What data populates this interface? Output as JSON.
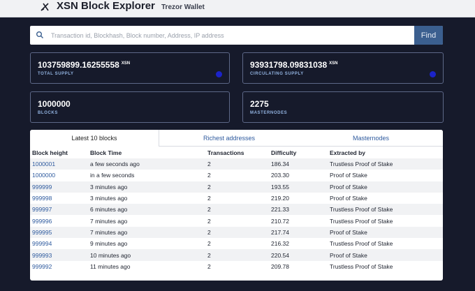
{
  "header": {
    "brand": "XSN Block Explorer",
    "wallet_link": "Trezor Wallet",
    "logo_icon": "xsn-logo-icon"
  },
  "search": {
    "placeholder": "Transaction id, Blockhash, Block number, Address, IP address",
    "button_label": "Find",
    "icon": "search-icon"
  },
  "stats": {
    "total_supply": {
      "value": "103759899.16255558",
      "unit": "XSN",
      "label": "TOTAL SUPPLY"
    },
    "circulating_supply": {
      "value": "93931798.09831038",
      "unit": "XSN",
      "label": "CIRCULATING SUPPLY"
    },
    "blocks": {
      "value": "1000000",
      "label": "BLOCKS"
    },
    "masternodes": {
      "value": "2275",
      "label": "MASTERNODES"
    }
  },
  "tabs": [
    {
      "label": "Latest 10 blocks"
    },
    {
      "label": "Richest addresses"
    },
    {
      "label": "Masternodes"
    }
  ],
  "table": {
    "headers": [
      "Block height",
      "Block Time",
      "Transactions",
      "Difficulty",
      "Extracted by"
    ],
    "rows": [
      [
        "1000001",
        "a few seconds ago",
        "2",
        "186.34",
        "Trustless Proof of Stake"
      ],
      [
        "1000000",
        "in a few seconds",
        "2",
        "203.30",
        "Proof of Stake"
      ],
      [
        "999999",
        "3 minutes ago",
        "2",
        "193.55",
        "Proof of Stake"
      ],
      [
        "999998",
        "3 minutes ago",
        "2",
        "219.20",
        "Proof of Stake"
      ],
      [
        "999997",
        "6 minutes ago",
        "2",
        "221.33",
        "Trustless Proof of Stake"
      ],
      [
        "999996",
        "7 minutes ago",
        "2",
        "210.72",
        "Trustless Proof of Stake"
      ],
      [
        "999995",
        "7 minutes ago",
        "2",
        "217.74",
        "Proof of Stake"
      ],
      [
        "999994",
        "9 minutes ago",
        "2",
        "216.32",
        "Trustless Proof of Stake"
      ],
      [
        "999993",
        "10 minutes ago",
        "2",
        "220.54",
        "Proof of Stake"
      ],
      [
        "999992",
        "11 minutes ago",
        "2",
        "209.78",
        "Trustless Proof of Stake"
      ]
    ]
  },
  "colors": {
    "background": "#161a2b",
    "accent": "#3b5f8f",
    "link": "#2e5a9e",
    "dot": "#1b23c9"
  }
}
